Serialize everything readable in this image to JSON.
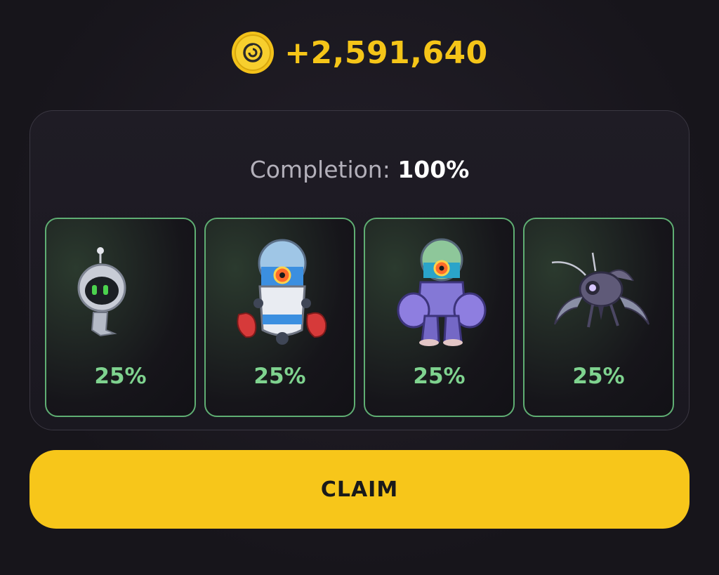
{
  "reward": {
    "amount": "+2,591,640",
    "icon": "coin-icon",
    "color": "#f5c518"
  },
  "completion": {
    "label": "Completion:",
    "value": "100%"
  },
  "cards": [
    {
      "icon": "small-robot-icon",
      "percent": "25%"
    },
    {
      "icon": "boxer-robot-icon",
      "percent": "25%"
    },
    {
      "icon": "mech-robot-icon",
      "percent": "25%"
    },
    {
      "icon": "spider-robot-icon",
      "percent": "25%"
    }
  ],
  "claim_button": {
    "label": "CLAIM",
    "color": "#f7c61a"
  },
  "colors": {
    "accent_green": "#7fd38f",
    "card_border": "#5fae73",
    "background": "#17151b"
  }
}
